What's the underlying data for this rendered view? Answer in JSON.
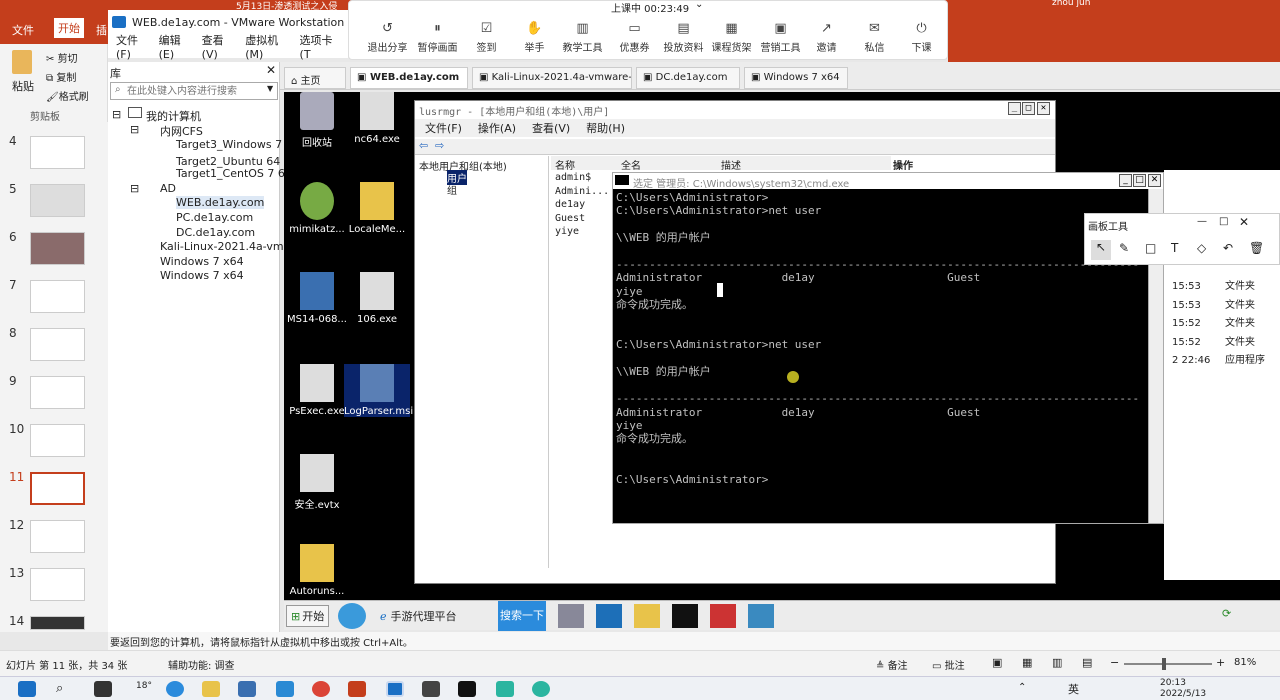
{
  "ppt": {
    "tabs": [
      "文件",
      "开始",
      "插"
    ],
    "ribbon": {
      "paste": "粘贴",
      "cut": "剪切",
      "copy": "复制",
      "format_painter": "格式刷",
      "clipboard": "剪贴板"
    },
    "slides": [
      "4",
      "5",
      "6",
      "7",
      "8",
      "9",
      "10",
      "11",
      "12",
      "13",
      "14"
    ],
    "status": {
      "slide_count": "幻灯片 第 11 张，共 34 张",
      "accessibility": "辅助功能: 调查",
      "notes": "备注",
      "comments": "批注",
      "zoom": "81%"
    },
    "top_text": "5月13日-渗透测试之入侵"
  },
  "vmware": {
    "title": "WEB.de1ay.com - VMware Workstation",
    "menu": [
      "文件(F)",
      "编辑(E)",
      "查看(V)",
      "虚拟机(M)",
      "选项卡(T"
    ],
    "library_title": "库",
    "search_placeholder": "在此处键入内容进行搜索",
    "tree": {
      "root": "我的计算机",
      "group1": "内网CFS",
      "group1_items": [
        "Target3_Windows 7 (",
        "Target2_Ubuntu 64 位",
        "Target1_CentOS 7 64"
      ],
      "group2": "AD",
      "group2_items": [
        "WEB.de1ay.com",
        "PC.de1ay.com",
        "DC.de1ay.com"
      ],
      "others": [
        "Kali-Linux-2021.4a-vmwa",
        "Windows 7 x64",
        "Windows 7 x64"
      ]
    },
    "tabs": [
      "主页",
      "WEB.de1ay.com",
      "Kali-Linux-2021.4a-vmware-am...",
      "DC.de1ay.com",
      "Windows 7 x64"
    ],
    "status_hint": "要返回到您的计算机，请将鼠标指针从虚拟机中移出或按 Ctrl+Alt。"
  },
  "meeting": {
    "status": "上课中 00:23:49",
    "buttons": [
      "退出分享",
      "暂停画面",
      "签到",
      "举手",
      "教学工具",
      "优惠券",
      "投放资料",
      "课程货架",
      "营销工具",
      "邀请",
      "私信",
      "下课"
    ],
    "user": "zhou jun"
  },
  "guest": {
    "desktop_icons": [
      "回收站",
      "nc64.exe",
      "mimikatz...",
      "LocaleMe...",
      "MS14-068...",
      "106.exe",
      "PsExec.exe",
      "LogParser.msi",
      "安全.evtx",
      "Autoruns..."
    ],
    "lusrmgr": {
      "title": "lusrmgr - [本地用户和组(本地)\\用户]",
      "menu": [
        "文件(F)",
        "操作(A)",
        "查看(V)",
        "帮助(H)"
      ],
      "tree_root": "本地用户和组(本地)",
      "tree_items": [
        "用户",
        "组"
      ],
      "columns": [
        "名称",
        "全名",
        "描述",
        "操作"
      ],
      "users": [
        "admin$",
        "Admini...",
        "de1ay",
        "Guest",
        "yiye"
      ],
      "right_rows": [
        {
          "time": "15:53",
          "type": "文件夹"
        },
        {
          "time": "15:53",
          "type": "文件夹"
        },
        {
          "time": "15:52",
          "type": "文件夹"
        },
        {
          "time": "15:52",
          "type": "文件夹"
        },
        {
          "time": "2 22:46",
          "type": "应用程序"
        }
      ]
    },
    "cmd": {
      "title": "选定 管理员: C:\\Windows\\system32\\cmd.exe",
      "text": "C:\\Users\\Administrator>\nC:\\Users\\Administrator>net user\n\n\\\\WEB 的用户帐户\n\n-------------------------------------------------------------------------------\nAdministrator            de1ay                    Guest\nyiye\n命令成功完成。\n\n\nC:\\Users\\Administrator>net user\n\n\\\\WEB 的用户帐户\n\n-------------------------------------------------------------------------------\nAdministrator            de1ay                    Guest\nyiye\n命令成功完成。\n\n\nC:\\Users\\Administrator>"
    },
    "draw_tool_title": "画板工具",
    "taskbar": {
      "start": "开始",
      "browser": "手游代理平台",
      "search": "搜索一下"
    }
  },
  "windows": {
    "time": "20:13",
    "date": "2022/5/13",
    "lang": "英",
    "weather": "18°"
  },
  "colors": {
    "ppt_red": "#c43e1c",
    "cmd_bg": "#000000",
    "xp_blue": "#0a246a"
  }
}
